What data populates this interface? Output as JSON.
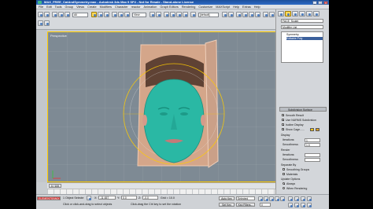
{
  "window": {
    "title": "MAX_FREE_CatAndSymmetry.max - Autodesk 3ds Max 9 SP2 - Not for Resale - Stand-alone License",
    "controls": [
      "_",
      "□",
      "x"
    ]
  },
  "menu": [
    "File",
    "Edit",
    "Tools",
    "Group",
    "Views",
    "Create",
    "Modifiers",
    "Character",
    "reactor",
    "Animation",
    "Graph Editors",
    "Rendering",
    "Customize",
    "MAXScript",
    "Help",
    "Extras",
    "Help"
  ],
  "toolbar": {
    "selection_filter": "All",
    "reference_coord": "View",
    "named_selection": "[default]"
  },
  "viewport": {
    "label": "Perspective"
  },
  "right_panel": {
    "object_name": "FACE_Sculpt",
    "modifier_list_label": "Modifier List",
    "stack_items": [
      "Symmetry",
      "Editable Poly"
    ],
    "rollout_title": "Subdivision Surface",
    "options": [
      {
        "label": "Smooth Result",
        "checked": true
      },
      {
        "label": "Use NURMS Subdivision",
        "checked": true
      },
      {
        "label": "Isoline Display",
        "checked": true
      },
      {
        "label": "Show Cage......",
        "checked": true
      }
    ],
    "display_label": "Display",
    "iterations_label": "Iterations:",
    "iterations_value": "1",
    "smoothness_label": "Smoothness:",
    "smoothness_value": "1.0",
    "render_label": "Render",
    "render_iterations": "Iterations:",
    "render_smoothness": "Smoothness:",
    "separate_by_label": "Separate By",
    "smoothing_groups": "Smoothing Groups",
    "materials": "Materials",
    "update_options_label": "Update Options",
    "always": "Always",
    "when_rendering": "When Rendering"
  },
  "timeline": {
    "frame": "0 / 100"
  },
  "status": {
    "listener": "ELEMENTS/MAX",
    "selected": "1 Object Selecte",
    "prompt": "Click or click-and-drag to select objects",
    "hint": "Click-drag the Ctrl key to set the rotation",
    "x": "-11.657",
    "y": "0.0",
    "z": "-0.0",
    "grid": "Grid = 10.0",
    "auto_key": "Auto Key",
    "selected_key": "Selected",
    "set_key": "Set Key",
    "key_filters": "Key Filters...",
    "frame_field": "0"
  },
  "colors": {
    "face_mesh": "#2ab8a4",
    "selection_gizmo": "#ffcc00",
    "viewport_bg": "#7e8a94"
  }
}
